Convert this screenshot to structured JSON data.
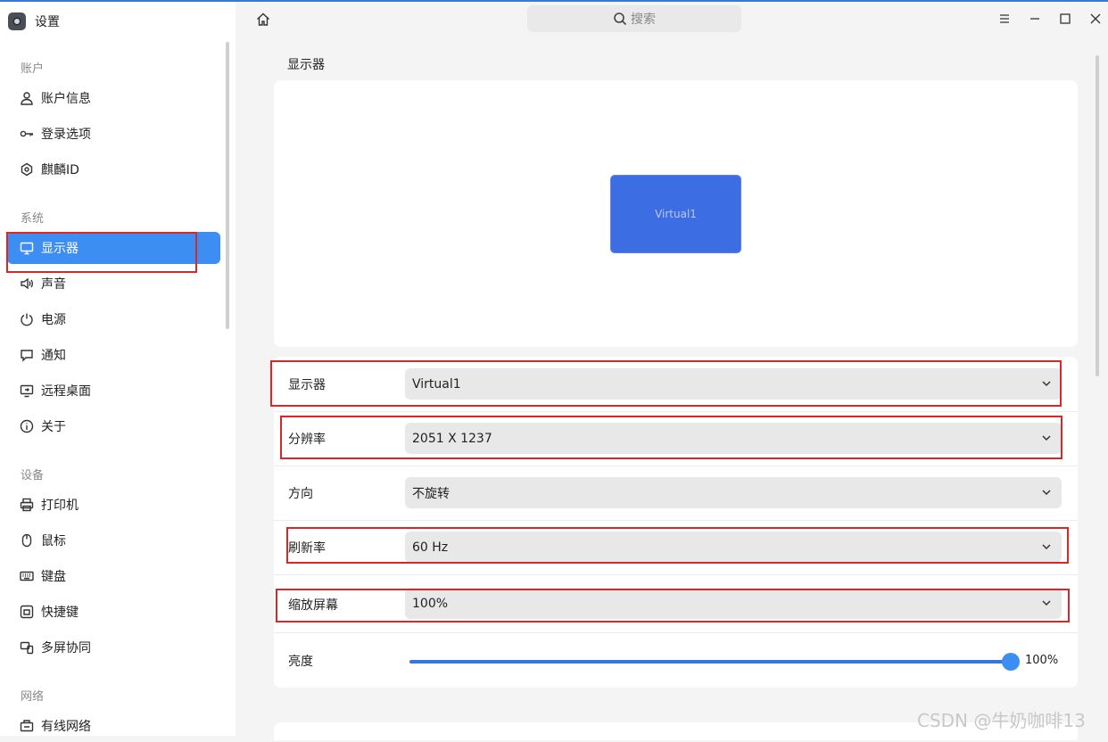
{
  "app": {
    "title": "设置"
  },
  "sidebar": {
    "sections": [
      {
        "title": "账户",
        "items": [
          {
            "label": "账户信息",
            "icon": "user-icon"
          },
          {
            "label": "登录选项",
            "icon": "key-icon"
          },
          {
            "label": "麒麟ID",
            "icon": "cloud-id-icon"
          }
        ]
      },
      {
        "title": "系统",
        "items": [
          {
            "label": "显示器",
            "icon": "monitor-icon",
            "active": true
          },
          {
            "label": "声音",
            "icon": "speaker-icon"
          },
          {
            "label": "电源",
            "icon": "power-icon"
          },
          {
            "label": "通知",
            "icon": "notification-icon"
          },
          {
            "label": "远程桌面",
            "icon": "remote-desktop-icon"
          },
          {
            "label": "关于",
            "icon": "info-icon"
          }
        ]
      },
      {
        "title": "设备",
        "items": [
          {
            "label": "打印机",
            "icon": "printer-icon"
          },
          {
            "label": "鼠标",
            "icon": "mouse-icon"
          },
          {
            "label": "键盘",
            "icon": "keyboard-icon"
          },
          {
            "label": "快捷键",
            "icon": "shortcut-icon"
          },
          {
            "label": "多屏协同",
            "icon": "multiscreen-icon"
          }
        ]
      },
      {
        "title": "网络",
        "items": [
          {
            "label": "有线网络",
            "icon": "wired-network-icon"
          }
        ]
      }
    ]
  },
  "header": {
    "search_placeholder": "搜索"
  },
  "main": {
    "page_title": "显示器",
    "preview": {
      "monitor_name": "Virtual1"
    },
    "settings": {
      "display": {
        "label": "显示器",
        "value": "Virtual1"
      },
      "resolution": {
        "label": "分辨率",
        "value": "2051 X 1237"
      },
      "orientation": {
        "label": "方向",
        "value": "不旋转"
      },
      "refresh_rate": {
        "label": "刷新率",
        "value": "60 Hz"
      },
      "scale": {
        "label": "缩放屏幕",
        "value": "100%"
      },
      "brightness": {
        "label": "亮度",
        "value_text": "100%",
        "level": 1.0
      }
    }
  },
  "colors": {
    "accent": "#3d8ef3",
    "monitor_preview": "#3d6de3",
    "highlight_box": "#d62828"
  },
  "watermark": "CSDN @牛奶咖啡13"
}
